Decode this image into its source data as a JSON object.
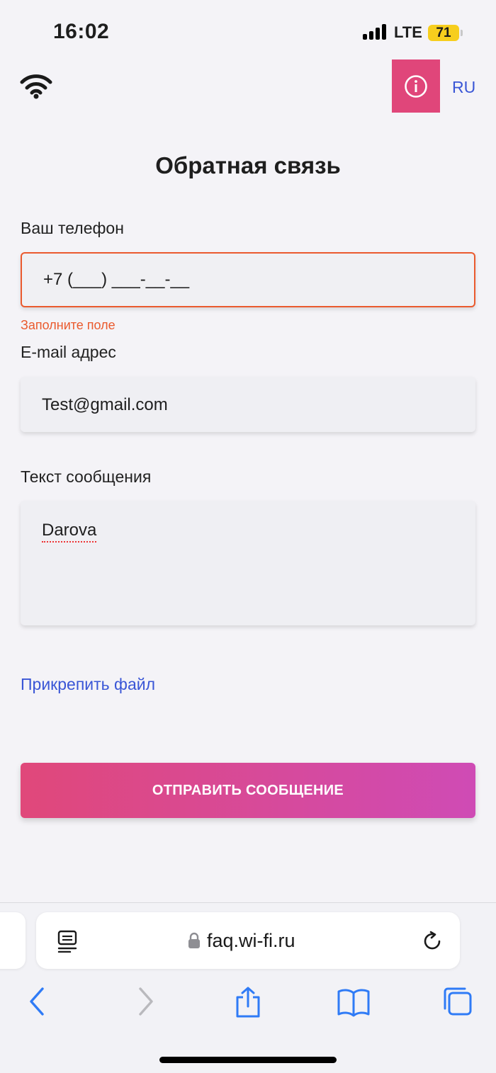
{
  "status_bar": {
    "time": "16:02",
    "network": "LTE",
    "battery": "71"
  },
  "header": {
    "lang": "RU"
  },
  "form": {
    "title": "Обратная связь",
    "phone_label": "Ваш телефон",
    "phone_placeholder": "+7 (___) ___-__-__",
    "phone_error": "Заполните поле",
    "email_label": "E-mail адрес",
    "email_value": "Test@gmail.com",
    "message_label": "Текст сообщения",
    "message_value": "Darova",
    "attach_label": "Прикрепить файл",
    "submit_label": "ОТПРАВИТЬ СООБЩЕНИЕ"
  },
  "browser": {
    "url": "faq.wi-fi.ru"
  },
  "colors": {
    "accent_pink": "#e0467a",
    "link_blue": "#3a56d6",
    "error": "#ea5a2e",
    "gradient_end": "#cf4bb5"
  },
  "icons": [
    "wifi-icon",
    "info-icon",
    "reader-icon",
    "lock-icon",
    "reload-icon",
    "back-icon",
    "forward-icon",
    "share-icon",
    "bookmarks-icon",
    "tabs-icon"
  ]
}
